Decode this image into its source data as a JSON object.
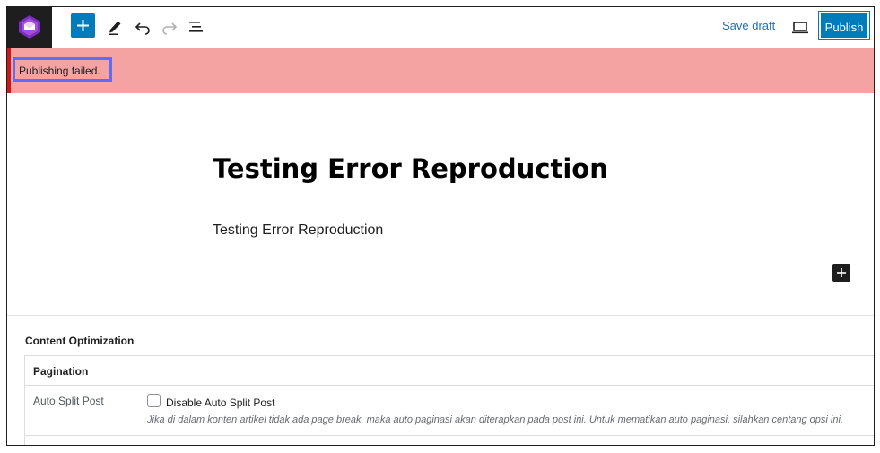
{
  "toolbar": {
    "save_draft_label": "Save draft",
    "publish_label": "Publish",
    "accent_color": "#007cba"
  },
  "notice": {
    "message": "Publishing failed.",
    "background_color": "#f4a2a2"
  },
  "editor": {
    "title": "Testing Error Reproduction",
    "paragraph": "Testing Error Reproduction"
  },
  "metabox": {
    "title": "Content Optimization",
    "section_title": "Pagination",
    "field_label": "Auto Split Post",
    "checkbox_label": "Disable Auto Split Post",
    "checkbox_checked": false,
    "description": "Jika di dalam konten artikel tidak ada page break, maka auto paginasi akan diterapkan pada post ini. Untuk mematikan auto paginasi, silahkan centang opsi ini."
  }
}
